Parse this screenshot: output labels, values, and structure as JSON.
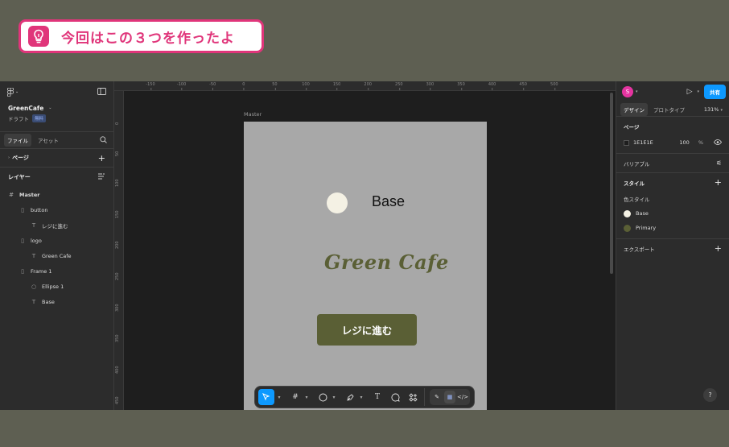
{
  "callout": {
    "text": "今回はこの３つを作ったよ",
    "icon": "lightbulb-icon"
  },
  "left_panel": {
    "file_name": "GreenCafe",
    "drafts_label": "ドラフト",
    "plan_badge": "無料",
    "tabs": [
      "ファイル",
      "アセット"
    ],
    "pages_label": "ページ",
    "layers_label": "レイヤー",
    "layers": [
      {
        "name": "Master",
        "icon": "frame-grid-icon",
        "depth": 0
      },
      {
        "name": "button",
        "icon": "auto-layout-icon",
        "depth": 1
      },
      {
        "name": "レジに進む",
        "icon": "text-icon",
        "depth": 2
      },
      {
        "name": "logo",
        "icon": "auto-layout-icon",
        "depth": 1
      },
      {
        "name": "Green Cafe",
        "icon": "text-icon",
        "depth": 2
      },
      {
        "name": "Frame 1",
        "icon": "auto-layout-icon",
        "depth": 1
      },
      {
        "name": "Ellipse 1",
        "icon": "ellipse-icon",
        "depth": 2
      },
      {
        "name": "Base",
        "icon": "text-icon",
        "depth": 2
      }
    ]
  },
  "canvas": {
    "ruler_top": [
      "-150",
      "-100",
      "-50",
      "0",
      "50",
      "100",
      "150",
      "200",
      "250",
      "300",
      "350",
      "400",
      "450",
      "500"
    ],
    "ruler_left": [
      "0",
      "50",
      "100",
      "150",
      "200",
      "250",
      "300",
      "350",
      "400",
      "450"
    ],
    "frame_label": "Master",
    "base_text": "Base",
    "logo_text": "Green Cafe",
    "button_text": "レジに進む",
    "colors": {
      "frame_bg": "#a8a8a8",
      "base": "#f4f1e4",
      "primary": "#5a5f35",
      "canvas_bg": "#1e1e1e"
    }
  },
  "toolbar": {
    "tools": [
      "move-tool-icon",
      "frame-tool-icon",
      "ellipse-tool-icon",
      "pen-tool-icon",
      "text-tool-icon",
      "comment-tool-icon",
      "component-tool-icon"
    ],
    "modes": [
      "draw-mode-icon",
      "design-mode-icon",
      "dev-mode-icon"
    ]
  },
  "right_panel": {
    "avatar_initial": "S",
    "share_label": "共有",
    "tabs": [
      "デザイン",
      "プロトタイプ"
    ],
    "zoom": "131%",
    "page_section": "ページ",
    "page_color_hex": "1E1E1E",
    "page_opacity": "100",
    "page_opacity_unit": "%",
    "variables_label": "バリアブル",
    "styles_label": "スタイル",
    "color_styles_label": "色スタイル",
    "color_styles": [
      {
        "name": "Base",
        "color": "#f4f1e4"
      },
      {
        "name": "Primary",
        "color": "#5a5f35"
      }
    ],
    "export_label": "エクスポート"
  },
  "help_label": "?"
}
